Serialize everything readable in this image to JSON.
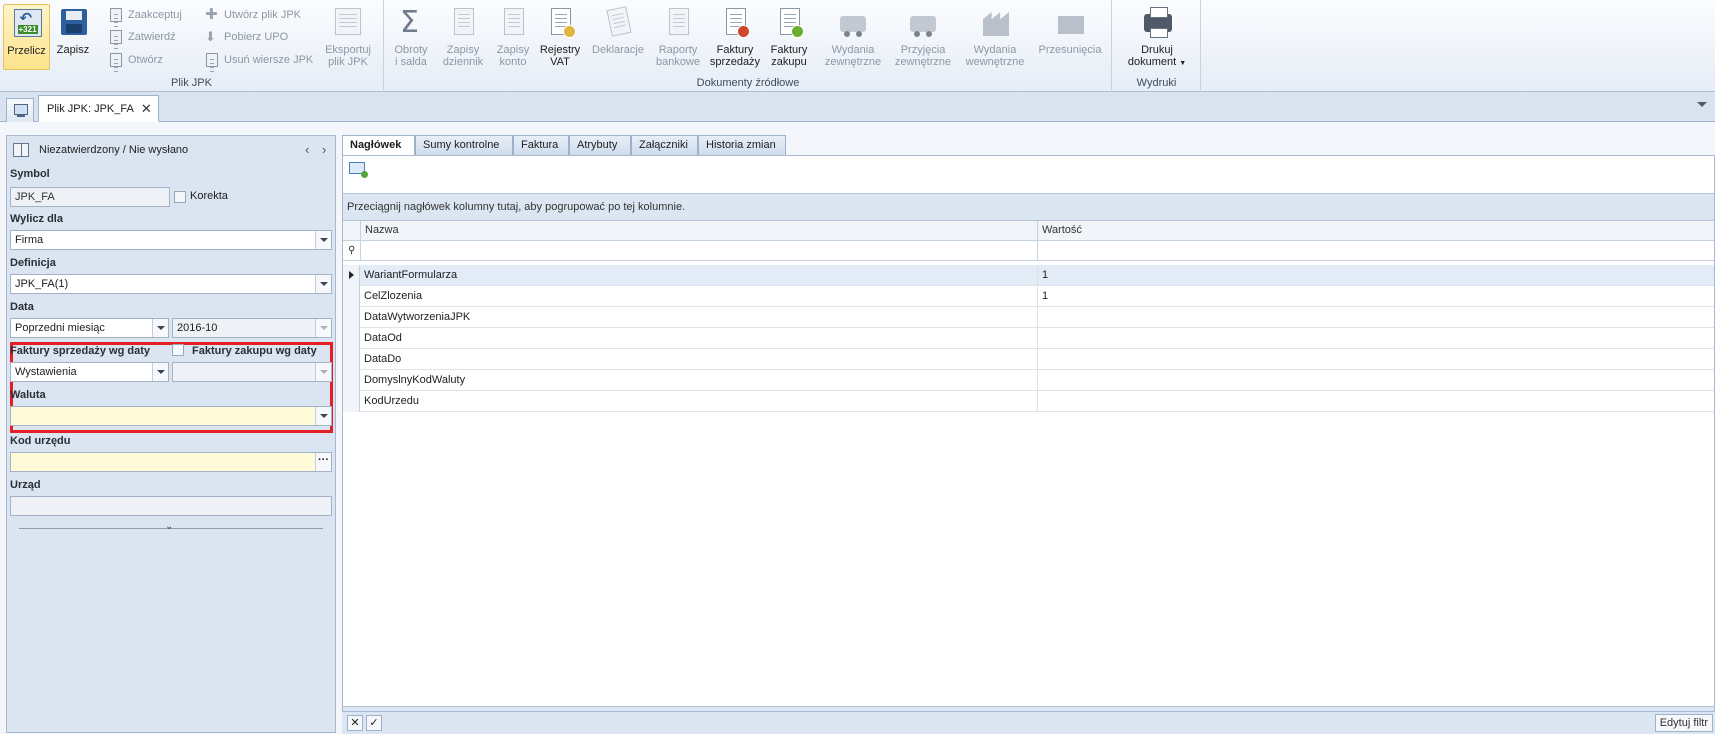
{
  "ribbon": {
    "przelicz": "Przelicz",
    "zapisz": "Zapisz",
    "zaakceptuj": "Zaakceptuj",
    "zatwierdz": "Zatwierdź",
    "otworz": "Otwórz",
    "utworz_plik": "Utwórz plik JPK",
    "pobierz_upo": "Pobierz UPO",
    "usun_wiersze": "Usuń wiersze JPK",
    "eksportuj": [
      "Eksportuj",
      "plik JPK"
    ],
    "group_plik_jpk": "Plik JPK",
    "obroty": [
      "Obroty",
      "i salda"
    ],
    "zapisy_dziennik": [
      "Zapisy",
      "dziennik"
    ],
    "zapisy_konto": [
      "Zapisy",
      "konto"
    ],
    "rejestry_vat": [
      "Rejestry",
      "VAT"
    ],
    "deklaracje": "Deklaracje",
    "raporty_bankowe": [
      "Raporty",
      "bankowe"
    ],
    "faktury_sprzedazy": [
      "Faktury",
      "sprzedaży"
    ],
    "faktury_zakupu": [
      "Faktury",
      "zakupu"
    ],
    "wydania_zewn": [
      "Wydania",
      "zewnętrzne"
    ],
    "przyjecia_zewn": [
      "Przyjęcia",
      "zewnętrzne"
    ],
    "wydania_wewn": [
      "Wydania",
      "wewnętrzne"
    ],
    "przesuniecia": "Przesunięcia",
    "group_dokumenty": "Dokumenty źródłowe",
    "drukuj": [
      "Drukuj",
      "dokument"
    ],
    "group_wydruki": "Wydruki"
  },
  "tabs": {
    "document_tab": "Plik JPK: JPK_FA"
  },
  "left_panel": {
    "status": "Niezatwierdzony / Nie wysłano",
    "symbol_label": "Symbol",
    "symbol_value": "JPK_FA",
    "korekta_label": "Korekta",
    "wylicz_label": "Wylicz dla",
    "wylicz_value": "Firma",
    "definicja_label": "Definicja",
    "definicja_value": "JPK_FA(1)",
    "data_label": "Data",
    "data_okres": "Poprzedni miesiąc",
    "data_value": "2016-10",
    "faktury_sprzedazy_label": "Faktury sprzedaży wg daty",
    "faktury_zakupu_label": "Faktury zakupu wg daty",
    "faktury_sprzedazy_value": "Wystawienia",
    "waluta_label": "Waluta",
    "waluta_value": "",
    "kod_urzedu_label": "Kod urzędu",
    "kod_urzedu_value": "",
    "urzad_label": "Urząd",
    "urzad_value": ""
  },
  "detail_tabs": [
    "Nagłówek",
    "Sumy kontrolne",
    "Faktura",
    "Atrybuty",
    "Załączniki",
    "Historia zmian"
  ],
  "grid": {
    "groupby_hint": "Przeciągnij nagłówek kolumny tutaj, aby pogrupować po tej kolumnie.",
    "col_nazwa": "Nazwa",
    "col_wartosc": "Wartość",
    "rows": [
      {
        "nazwa": "WariantFormularza",
        "wartosc": "1"
      },
      {
        "nazwa": "CelZlozenia",
        "wartosc": "1"
      },
      {
        "nazwa": "DataWytworzeniaJPK",
        "wartosc": ""
      },
      {
        "nazwa": "DataOd",
        "wartosc": ""
      },
      {
        "nazwa": "DataDo",
        "wartosc": ""
      },
      {
        "nazwa": "DomyslnyKodWaluty",
        "wartosc": ""
      },
      {
        "nazwa": "KodUrzedu",
        "wartosc": ""
      }
    ],
    "edit_filter": "Edytuj filtr"
  }
}
